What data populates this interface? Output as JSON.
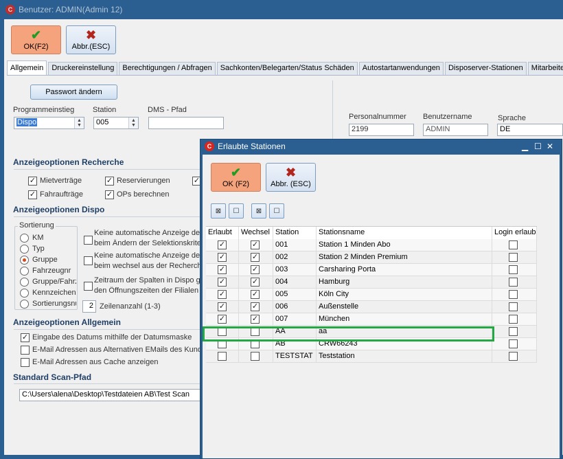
{
  "main_window": {
    "title": "Benutzer: ADMIN(Admin 12)",
    "toolbar": {
      "ok_label": "OK(F2)",
      "cancel_label": "Abbr.(ESC)"
    },
    "tabs": [
      "Allgemein",
      "Druckereinstellung",
      "Berechtigungen / Abfragen",
      "Sachkonten/Belegarten/Status Schäden",
      "Autostartanwendungen",
      "Disposerver-Stationen",
      "Mitarbeiterda"
    ],
    "password_button": "Passwort ändern",
    "fields": {
      "programmeinstieg_label": "Programmeinstieg",
      "programmeinstieg_value": "Dispo",
      "station_label": "Station",
      "station_value": "005",
      "dms_label": "DMS - Pfad",
      "dms_value": "",
      "personalnummer_label": "Personalnummer",
      "personalnummer_value": "2199",
      "benutzername_label": "Benutzername",
      "benutzername_value": "ADMIN",
      "sprache_label": "Sprache",
      "sprache_value": "DE"
    },
    "recherche": {
      "title": "Anzeigeoptionen Recherche",
      "options": [
        {
          "label": "Mietverträge",
          "checked": true
        },
        {
          "label": "Reservierungen",
          "checked": true
        },
        {
          "label": "Fahraufträge",
          "checked": true
        },
        {
          "label": "OPs berechnen",
          "checked": true
        }
      ]
    },
    "dispo": {
      "title": "Anzeigeoptionen Dispo",
      "sort_label": "Sortierung",
      "sort_options": [
        "KM",
        "Typ",
        "Gruppe",
        "Fahrzeugnr",
        "Gruppe/Fahrz",
        "Kennzeichen",
        "Sortierungsnu"
      ],
      "sort_selected": "Gruppe",
      "opt1": "Keine automatische Anzeige der",
      "opt1b": "beim Ändern der Selektionskriteri",
      "opt2": "Keine automatische Anzeige der",
      "opt2b": "beim wechsel aus der Recherche",
      "opt3": "Zeitraum der Spalten in Dispo gle",
      "opt3b": "den Öffnungszeiten der Filialen",
      "zeilen_value": "2",
      "zeilen_label": "Zeilenanzahl (1-3)"
    },
    "allgemein": {
      "title": "Anzeigeoptionen Allgemein",
      "options": [
        {
          "label": "Eingabe des Datums mithilfe der Datumsmaske",
          "checked": true
        },
        {
          "label": "E-Mail Adressen aus Alternativen EMails des Kunden",
          "checked": false
        },
        {
          "label": "E-Mail Adressen aus Cache anzeigen",
          "checked": false
        }
      ]
    },
    "scan": {
      "title": "Standard Scan-Pfad",
      "value": "C:\\Users\\alena\\Desktop\\Testdateien AB\\Test Scan"
    }
  },
  "dialog": {
    "title": "Erlaubte Stationen",
    "ok_label": "OK (F2)",
    "cancel_label": "Abbr. (ESC)",
    "columns": [
      "Erlaubt",
      "Wechsel",
      "Station",
      "Stationsname",
      "Login erlaub"
    ],
    "rows": [
      {
        "erlaubt": true,
        "wechsel": true,
        "station": "001",
        "name": "Station 1 Minden Abo",
        "login": false
      },
      {
        "erlaubt": true,
        "wechsel": true,
        "station": "002",
        "name": "Station 2 Minden Premium",
        "login": false
      },
      {
        "erlaubt": true,
        "wechsel": true,
        "station": "003",
        "name": "Carsharing Porta",
        "login": false
      },
      {
        "erlaubt": true,
        "wechsel": true,
        "station": "004",
        "name": "Hamburg",
        "login": false
      },
      {
        "erlaubt": true,
        "wechsel": true,
        "station": "005",
        "name": "Köln City",
        "login": false
      },
      {
        "erlaubt": true,
        "wechsel": true,
        "station": "006",
        "name": "Außenstelle",
        "login": false
      },
      {
        "erlaubt": true,
        "wechsel": true,
        "station": "007",
        "name": "München",
        "login": false
      },
      {
        "erlaubt": false,
        "wechsel": false,
        "station": "AA",
        "name": "aa",
        "login": false
      },
      {
        "erlaubt": false,
        "wechsel": false,
        "station": "AB",
        "name": "CRW66243",
        "login": false
      },
      {
        "erlaubt": false,
        "wechsel": false,
        "station": "TESTSTAT",
        "name": "Teststation",
        "login": false
      }
    ],
    "highlight_color": "#24a844"
  }
}
